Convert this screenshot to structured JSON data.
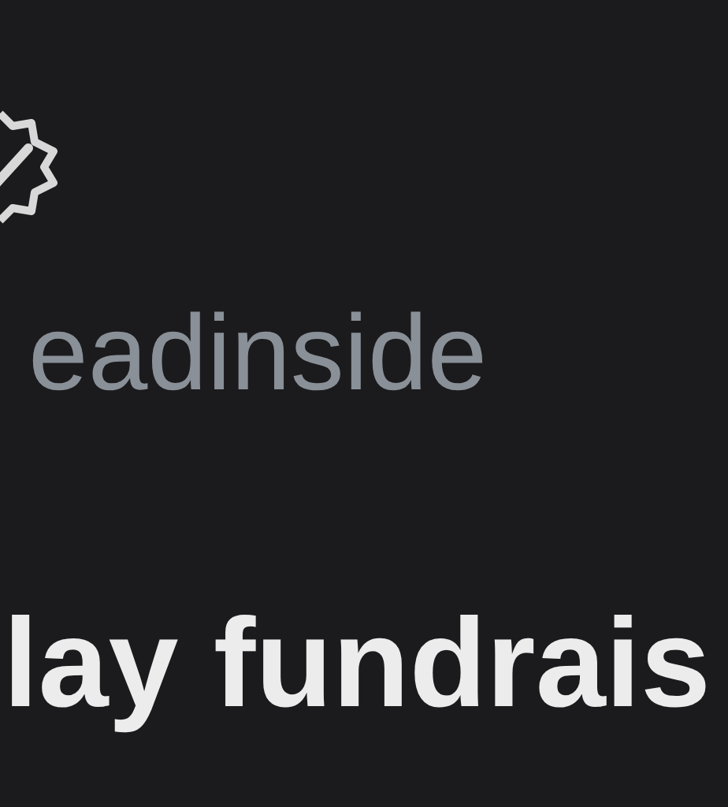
{
  "profile": {
    "handle": "eadinside",
    "verified": true
  },
  "post": {
    "title": "lay fundrais"
  }
}
